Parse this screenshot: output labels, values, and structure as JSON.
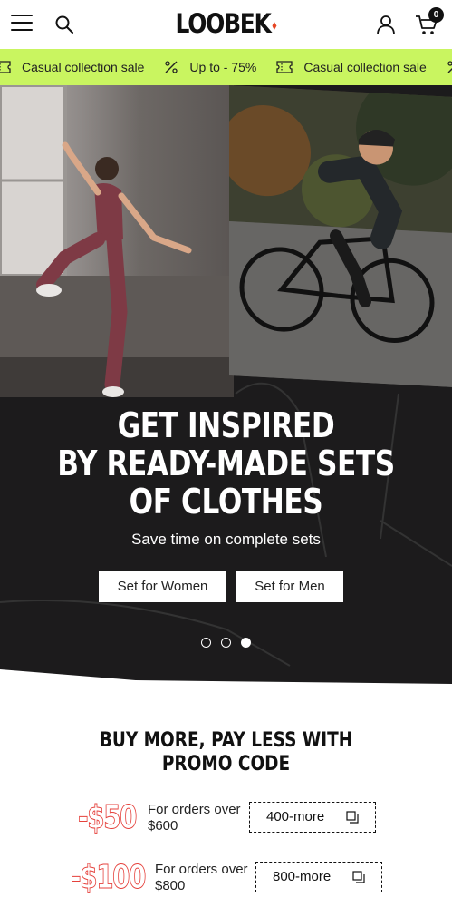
{
  "header": {
    "logo": "LOOBEK",
    "cart_count": "0",
    "icons": [
      "hamburger-menu-icon",
      "search-icon",
      "user-icon",
      "cart-icon"
    ]
  },
  "marquee": {
    "items": [
      {
        "icon": "ticket-icon",
        "label": "Casual collection sale"
      },
      {
        "icon": "percent-icon",
        "label": "Up to - 75%"
      },
      {
        "icon": "ticket-icon",
        "label": "Casual collection sale"
      },
      {
        "icon": "percent-icon",
        "label": ""
      }
    ],
    "background": "#c9f560"
  },
  "hero": {
    "title_lines": [
      "GET INSPIRED",
      "BY READY-MADE SETS",
      "OF CLOTHES"
    ],
    "subtitle": "Save time on complete sets",
    "buttons": {
      "women": "Set for Women",
      "men": "Set for Men"
    },
    "slides": 3,
    "active_slide": 3,
    "background": "#1c1b1c"
  },
  "promo": {
    "title_line1": "BUY MORE, PAY LESS WITH",
    "title_line2": "PROMO CODE",
    "offers": [
      {
        "amount": "-$50",
        "desc_line1": "For orders over",
        "desc_line2": "$600",
        "code": "400-more"
      },
      {
        "amount": "-$100",
        "desc_line1": "For orders over",
        "desc_line2": "$800",
        "code": "800-more"
      }
    ],
    "accent": "#e5413c"
  }
}
